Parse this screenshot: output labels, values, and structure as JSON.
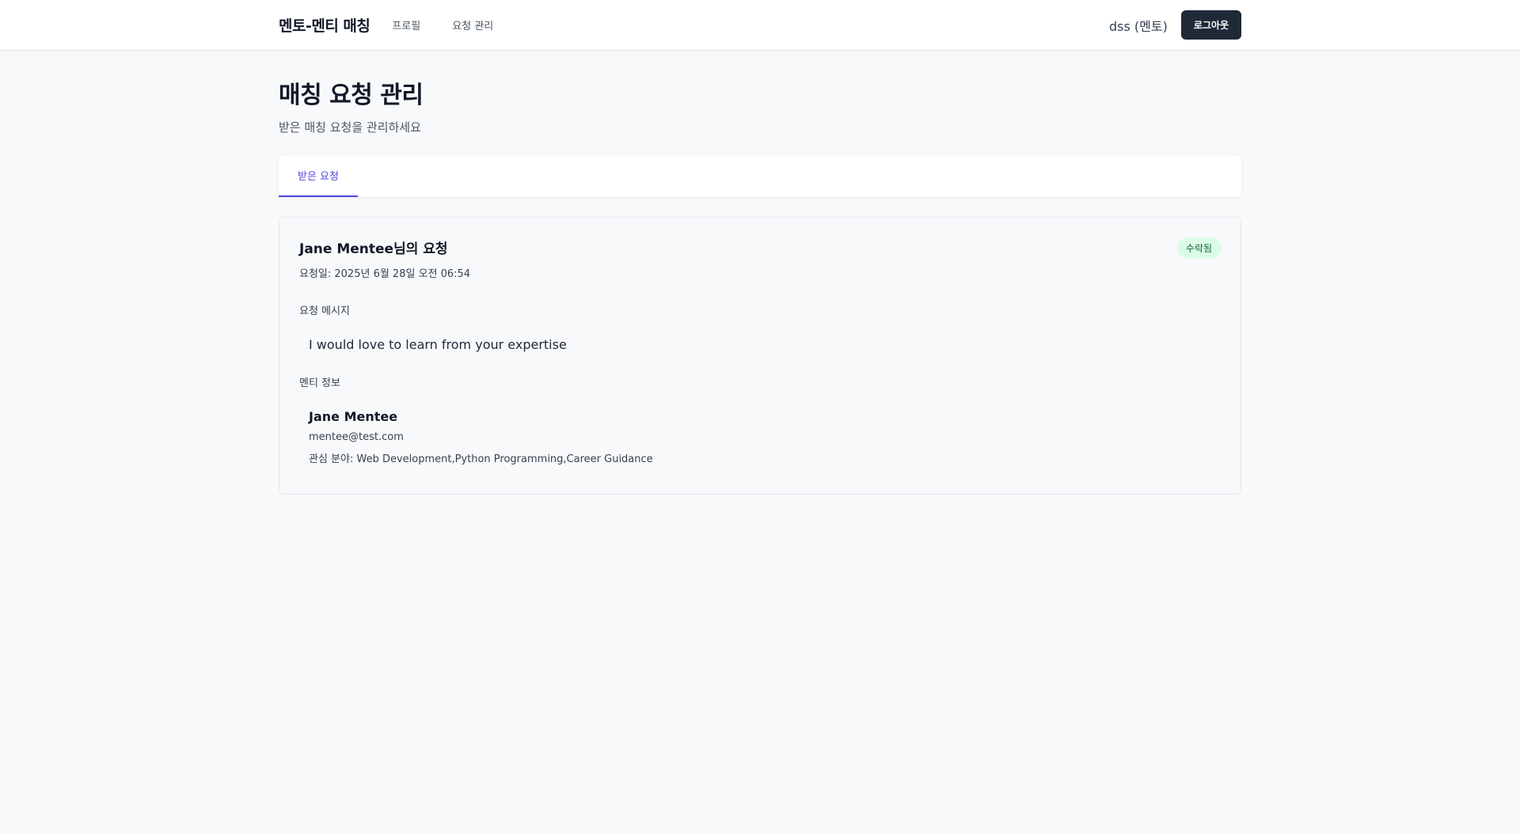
{
  "nav": {
    "brand": "멘토-멘티 매칭",
    "links": [
      "프로필",
      "요청 관리"
    ],
    "user_label": "dss (멘토)",
    "logout_label": "로그아웃"
  },
  "page": {
    "title": "매칭 요청 관리",
    "subtitle": "받은 매칭 요청을 관리하세요"
  },
  "tabs": [
    {
      "label": "받은 요청",
      "active": true
    }
  ],
  "request": {
    "title": "Jane Mentee님의 요청",
    "date": "요청일: 2025년 6월 28일 오전 06:54",
    "status": "수락됨",
    "message_label": "요청 메시지",
    "message": "I would love to learn from your expertise",
    "mentee_label": "멘티 정보",
    "mentee": {
      "name": "Jane Mentee",
      "email": "mentee@test.com",
      "interests": "관심 분야: Web Development,Python Programming,Career Guidance"
    }
  },
  "colors": {
    "accent": "#4f46e5",
    "logout_bg": "#1f2937",
    "status_bg": "#dcfce7",
    "status_text": "#166534"
  }
}
